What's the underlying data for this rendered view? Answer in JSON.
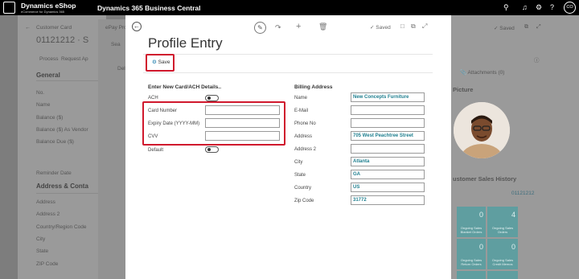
{
  "topbar": {
    "brand": "Dynamics eShop",
    "brand_sub": "eCommerce for Dynamics 365",
    "product": "Dynamics 365 Business Central",
    "user_initials": "CO"
  },
  "bg_customer_card": {
    "label": "Customer Card",
    "number": "01121212 · S",
    "actions": [
      "Process",
      "Request Ap"
    ],
    "general": "General",
    "fields": [
      "No.",
      "Name",
      "Balance ($)",
      "Balance ($) As Vendor",
      "Balance Due ($)"
    ],
    "reminder": "Reminder Date",
    "address_section": "Address & Conta",
    "address_fields": [
      "Address",
      "Address 2",
      "Country/Region Code",
      "City",
      "State",
      "ZIP Code"
    ]
  },
  "bg_epay": {
    "label": "ePay Pro",
    "search": "Sea",
    "dele": "Dele"
  },
  "bg_right": {
    "saved": "Saved",
    "attachments": "Attachments (0)",
    "picture": "Picture",
    "sales_history": "ustomer Sales History",
    "customer_no": "01121212",
    "tiles": [
      {
        "num": "0",
        "label": "Ongoing Sales Blanket Orders"
      },
      {
        "num": "4",
        "label": "Ongoing Sales Orders"
      },
      {
        "num": "0",
        "label": "Ongoing Sales Return Orders"
      },
      {
        "num": "0",
        "label": "Ongoing Sales Credit Memos"
      }
    ]
  },
  "modal": {
    "saved": "Saved",
    "title": "Profile Entry",
    "save_button": "Save",
    "card_section": "Enter New Card/ACH Details..",
    "ach_label": "ACH",
    "card_number_label": "Card Number",
    "expiry_label": "Expiry Date (YYYY-MM)",
    "cvv_label": "CVV",
    "default_label": "Default",
    "card_number_value": "",
    "expiry_value": "",
    "cvv_value": "",
    "billing_section": "Billing Address",
    "billing": [
      {
        "label": "Name",
        "value": "New Concepts Furniture"
      },
      {
        "label": "E-Mail",
        "value": ""
      },
      {
        "label": "Phone No",
        "value": ""
      },
      {
        "label": "Address",
        "value": "705 West Peachtree Street"
      },
      {
        "label": "Address 2",
        "value": ""
      },
      {
        "label": "City",
        "value": "Atlanta"
      },
      {
        "label": "State",
        "value": "GA"
      },
      {
        "label": "Country",
        "value": "US"
      },
      {
        "label": "Zip Code",
        "value": "31772"
      }
    ]
  },
  "colors": {
    "accent": "#1f7f8f",
    "highlight": "#d0192d",
    "tile": "#5f9ea0"
  }
}
